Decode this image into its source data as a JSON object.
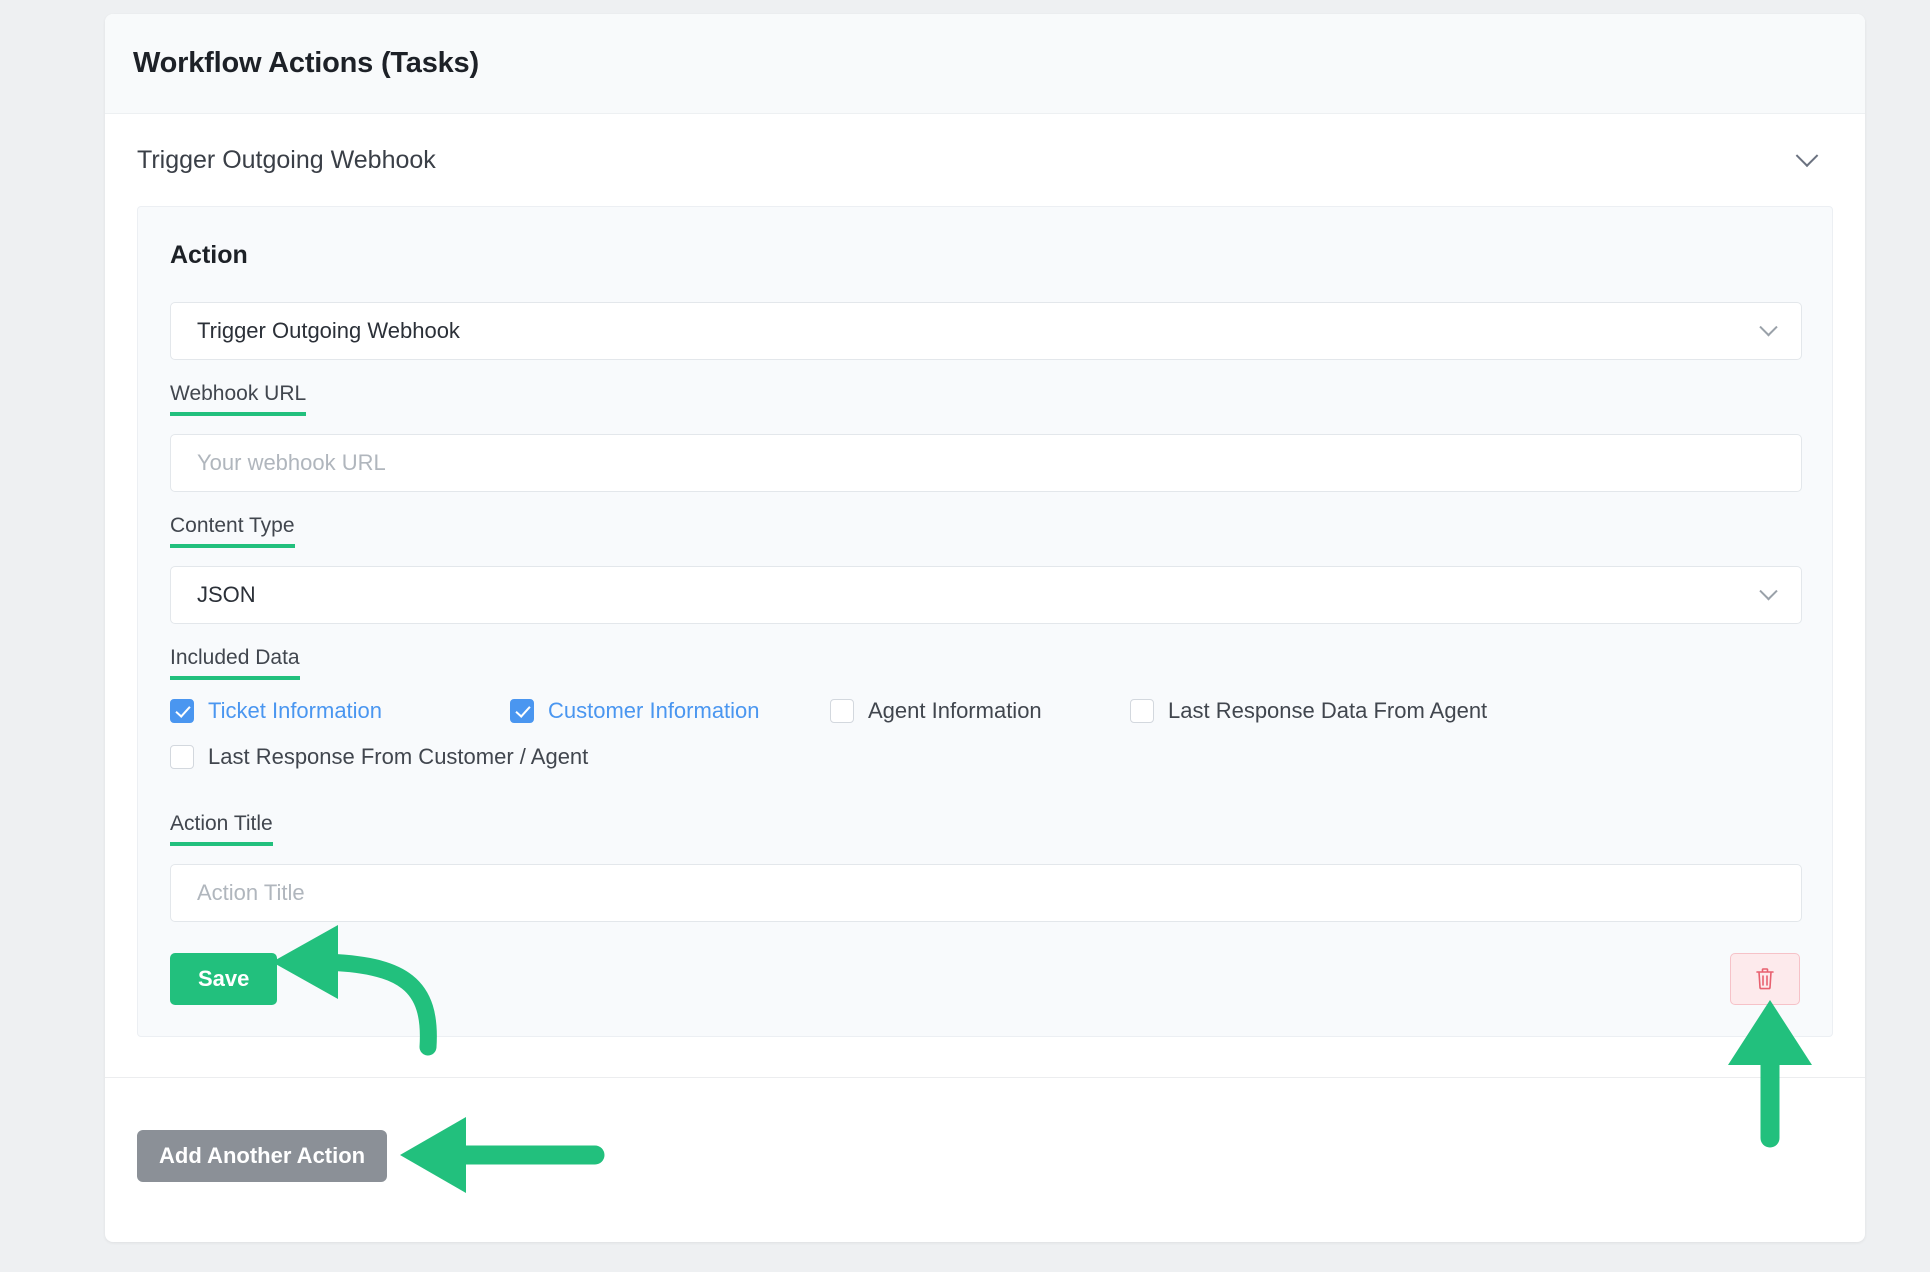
{
  "header": {
    "title": "Workflow Actions (Tasks)"
  },
  "accordion": {
    "title": "Trigger Outgoing Webhook",
    "chevron_icon": "chevron-down-icon"
  },
  "action_panel": {
    "heading": "Action",
    "action_select": {
      "label": "Action",
      "value": "Trigger Outgoing Webhook",
      "chevron_icon": "chevron-down-icon"
    },
    "webhook_url": {
      "label": "Webhook URL",
      "value": "",
      "placeholder": "Your webhook URL"
    },
    "content_type": {
      "label": "Content Type",
      "value": "JSON",
      "chevron_icon": "chevron-down-icon"
    },
    "included_data": {
      "label": "Included Data",
      "options": [
        {
          "label": "Ticket Information",
          "checked": true
        },
        {
          "label": "Customer Information",
          "checked": true
        },
        {
          "label": "Agent Information",
          "checked": false
        },
        {
          "label": "Last Response Data From Agent",
          "checked": false
        },
        {
          "label": "Last Response From Customer / Agent",
          "checked": false
        }
      ]
    },
    "action_title": {
      "label": "Action Title",
      "value": "",
      "placeholder": "Action Title"
    },
    "save_label": "Save",
    "delete_icon": "trash-icon"
  },
  "footer": {
    "add_another_label": "Add Another Action"
  },
  "colors": {
    "accent_green": "#22c07d",
    "checkbox_blue": "#4a96f0",
    "delete_red": "#e8606f",
    "delete_bg": "#fdeaec",
    "add_button_gray": "#8b9097",
    "page_bg": "#eef0f2",
    "panel_bg": "#f8fafc"
  },
  "annotations": [
    {
      "name": "arrow-to-save-button",
      "shape": "curved-arrow-left",
      "color": "#22c07d"
    },
    {
      "name": "arrow-to-delete-button",
      "shape": "straight-arrow-up",
      "color": "#22c07d"
    },
    {
      "name": "arrow-to-add-another-action",
      "shape": "straight-arrow-left",
      "color": "#22c07d"
    }
  ]
}
